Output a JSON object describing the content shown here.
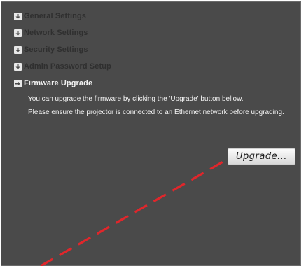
{
  "menu": {
    "items": [
      {
        "label": "General Settings",
        "icon": "arrow-down-icon",
        "active": false
      },
      {
        "label": "Network Settings",
        "icon": "arrow-down-icon",
        "active": false
      },
      {
        "label": "Security Settings",
        "icon": "arrow-down-icon",
        "active": false
      },
      {
        "label": "Admin Password Setup",
        "icon": "arrow-down-icon",
        "active": false
      },
      {
        "label": "Firmware Upgrade",
        "icon": "arrow-right-icon",
        "active": true
      }
    ]
  },
  "firmware": {
    "line1": "You can upgrade the firmware by clicking the 'Upgrade' button bellow.",
    "line2": "Please ensure the projector is connected to an Ethernet network before upgrading.",
    "upgrade_label": "Upgrade..."
  },
  "colors": {
    "panel_bg": "#4a4a4a",
    "annotation_dash": "#e0262b"
  }
}
